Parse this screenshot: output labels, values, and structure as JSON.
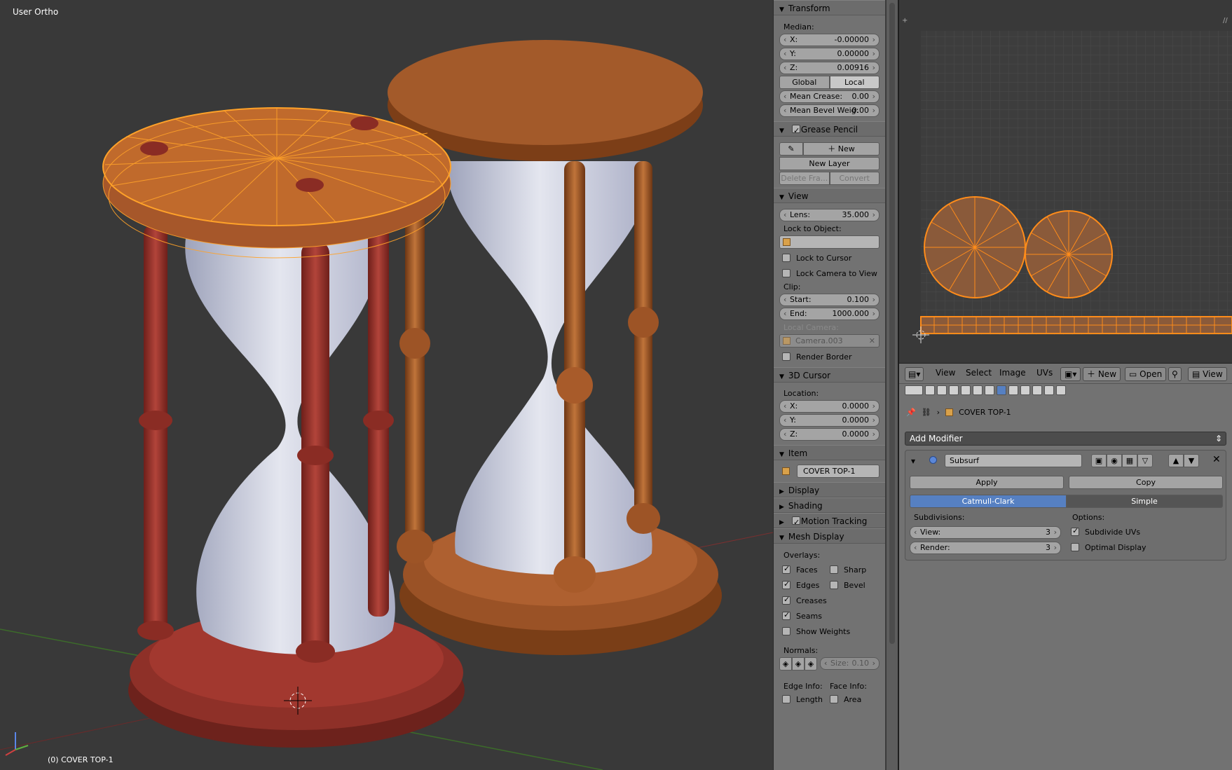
{
  "viewport": {
    "view_label": "User Ortho",
    "object_label": "(0) COVER TOP-1"
  },
  "transform": {
    "title": "Transform",
    "median_label": "Median:",
    "x_label": "X:",
    "x_value": "-0.00000",
    "y_label": "Y:",
    "y_value": "0.00000",
    "z_label": "Z:",
    "z_value": "0.00916",
    "global_label": "Global",
    "local_label": "Local",
    "crease_label": "Mean Crease:",
    "crease_value": "0.00",
    "bevel_label": "Mean Bevel Weig:",
    "bevel_value": "0.00"
  },
  "grease_pencil": {
    "title": "Grease Pencil",
    "new_label": "New",
    "new_layer_label": "New Layer",
    "delete_frame_label": "Delete Fra...",
    "convert_label": "Convert"
  },
  "view": {
    "title": "View",
    "lens_label": "Lens:",
    "lens_value": "35.000",
    "lock_object_label": "Lock to Object:",
    "lock_cursor_label": "Lock to Cursor",
    "lock_camera_label": "Lock Camera to View",
    "clip_label": "Clip:",
    "start_label": "Start:",
    "start_value": "0.100",
    "end_label": "End:",
    "end_value": "1000.000",
    "local_camera_label": "Local Camera:",
    "camera_value": "Camera.003",
    "render_border_label": "Render Border"
  },
  "cursor": {
    "title": "3D Cursor",
    "location_label": "Location:",
    "x_label": "X:",
    "x_value": "0.0000",
    "y_label": "Y:",
    "y_value": "0.0000",
    "z_label": "Z:",
    "z_value": "0.0000"
  },
  "item": {
    "title": "Item",
    "name": "COVER TOP-1"
  },
  "panels": {
    "display": "Display",
    "shading": "Shading",
    "motion_tracking": "Motion Tracking",
    "mesh_display": "Mesh Display"
  },
  "mesh_display": {
    "overlays_label": "Overlays:",
    "faces": "Faces",
    "sharp": "Sharp",
    "edges": "Edges",
    "bevel": "Bevel",
    "creases": "Creases",
    "seams": "Seams",
    "show_weights": "Show Weights",
    "normals_label": "Normals:",
    "size_label": "Size:",
    "size_value": "0.10",
    "edge_info_label": "Edge Info:",
    "face_info_label": "Face Info:",
    "length": "Length",
    "area": "Area"
  },
  "uv_header": {
    "menu_view": "View",
    "menu_select": "Select",
    "menu_image": "Image",
    "menu_uvs": "UVs",
    "new_label": "New",
    "open_label": "Open",
    "view_label": "View"
  },
  "modifiers": {
    "object_name": "COVER TOP-1",
    "add_modifier_label": "Add Modifier",
    "modifier_name": "Subsurf",
    "apply_label": "Apply",
    "copy_label": "Copy",
    "catmull_label": "Catmull-Clark",
    "simple_label": "Simple",
    "subdivisions_label": "Subdivisions:",
    "view_label": "View:",
    "view_value": "3",
    "render_label": "Render:",
    "render_value": "3",
    "options_label": "Options:",
    "subdivide_uvs_label": "Subdivide UVs",
    "optimal_display_label": "Optimal Display"
  },
  "colors": {
    "selection_orange": "#ffa229",
    "red_wood": "#9a342c",
    "brown_wood": "#a35a2a",
    "glass": "#c9ccdb",
    "accent_blue": "#5680c2"
  }
}
